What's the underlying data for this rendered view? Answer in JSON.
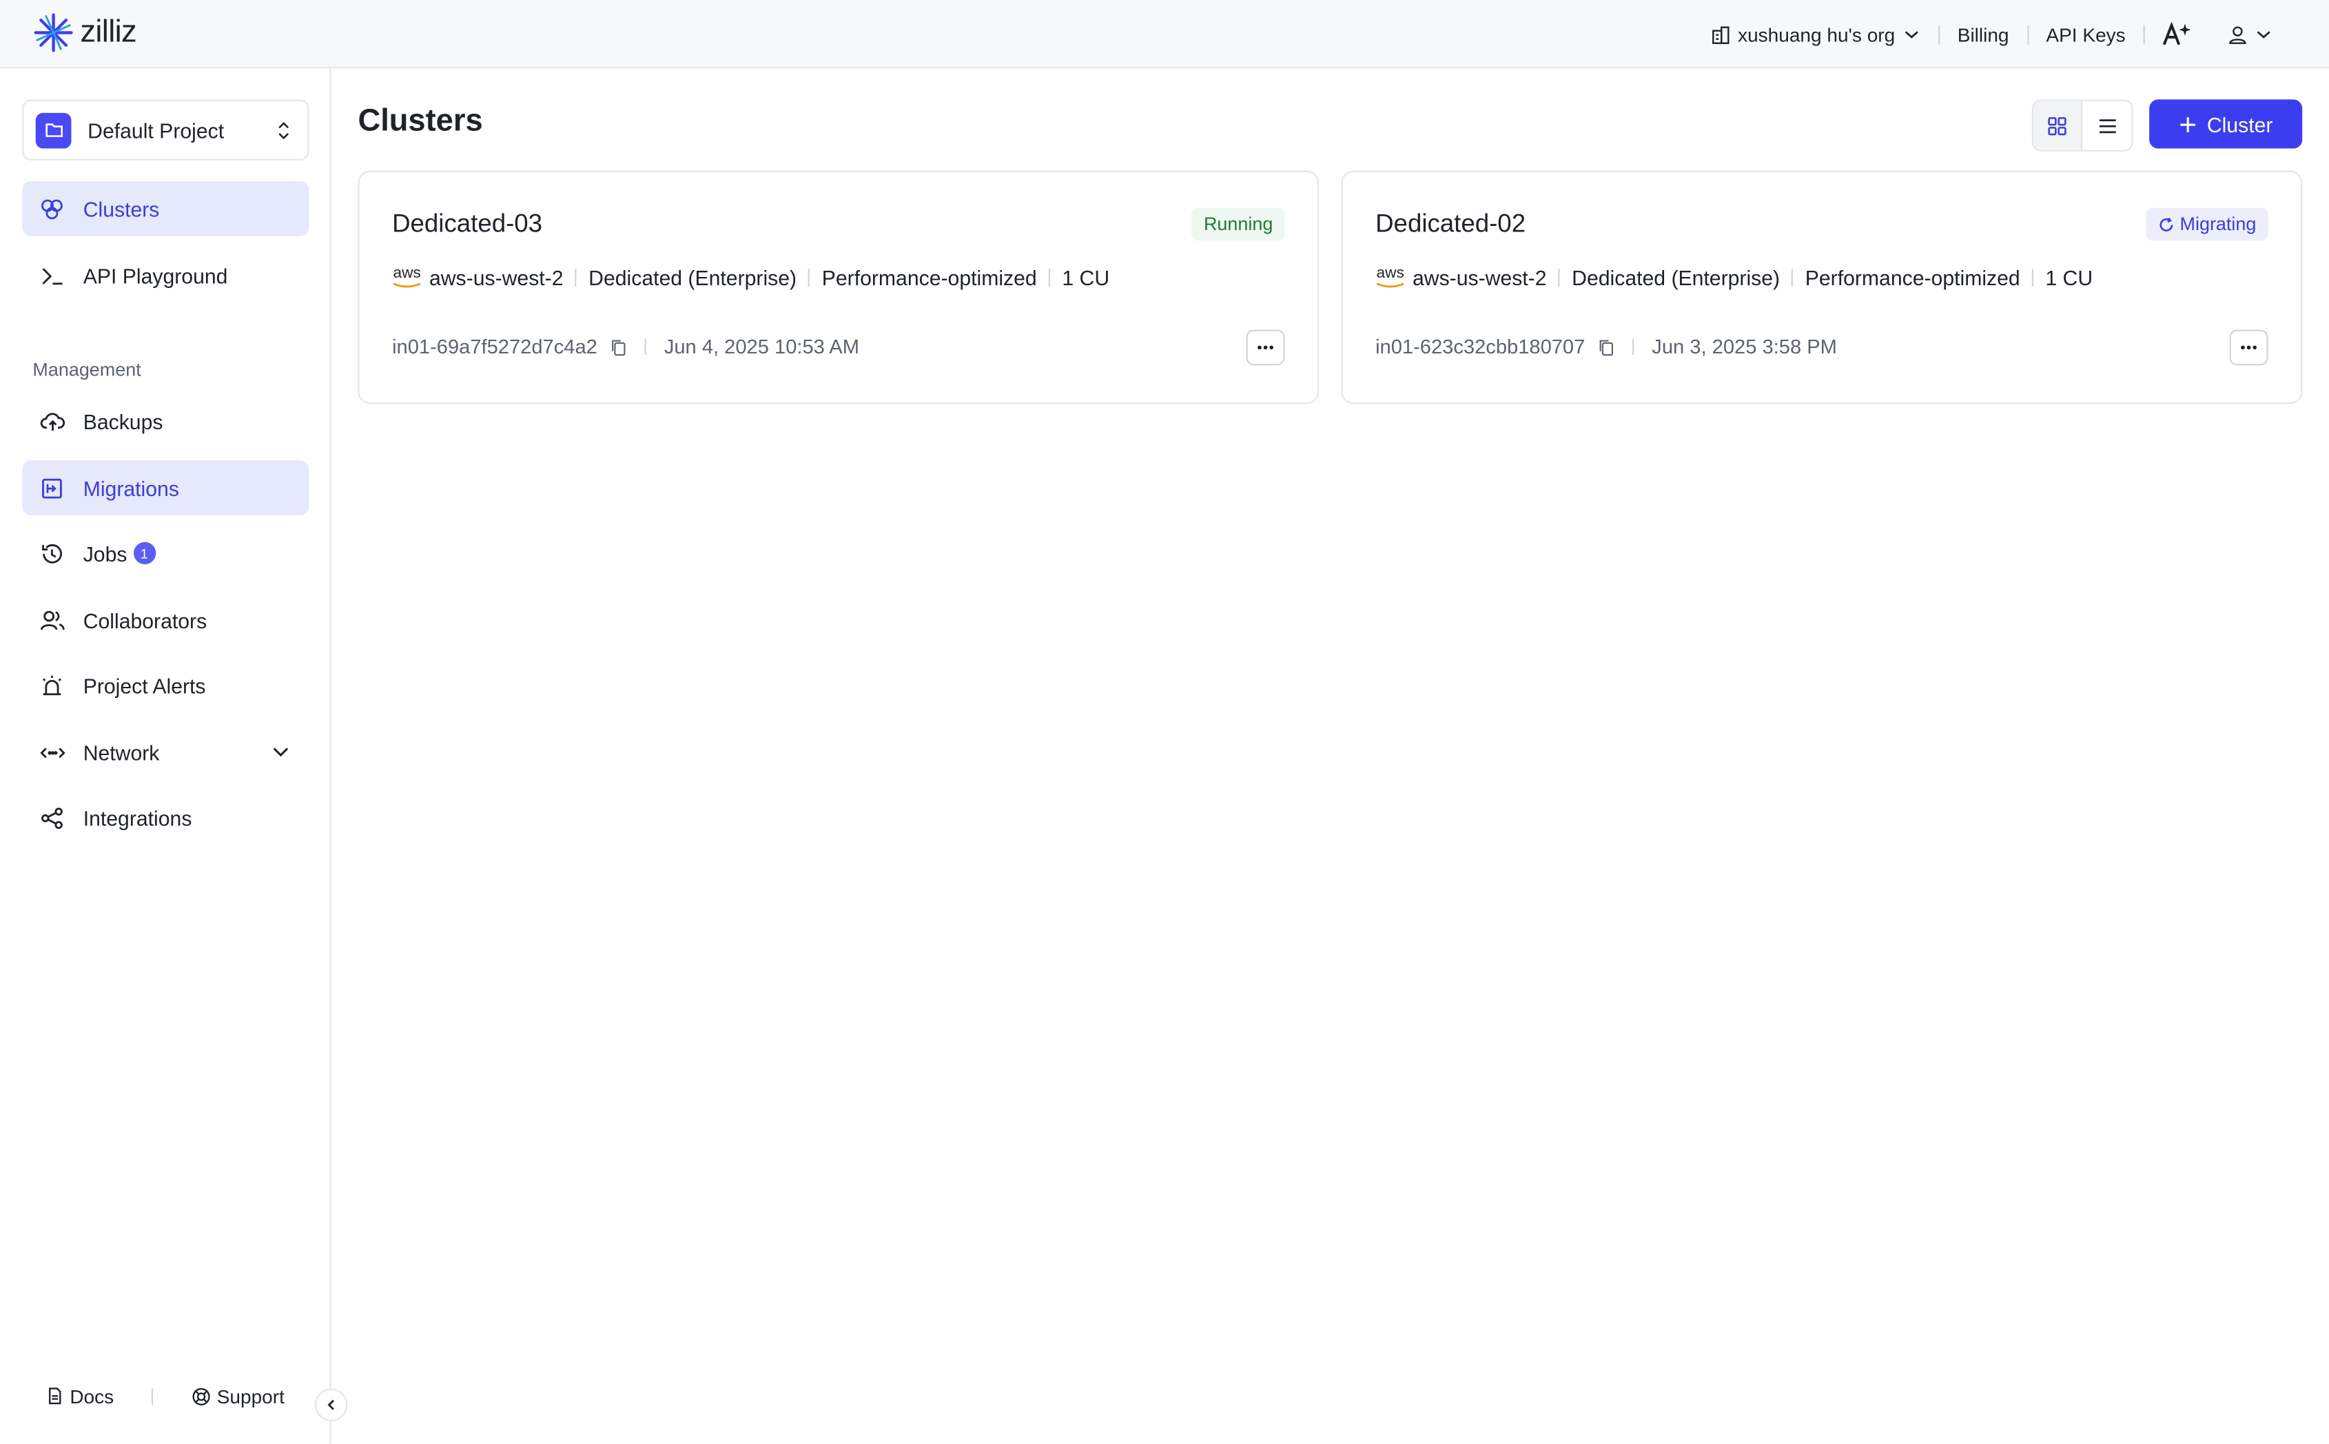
{
  "brand": {
    "name": "zilliz"
  },
  "topbar": {
    "org": "xushuang hu's org",
    "billing": "Billing",
    "api_keys": "API Keys"
  },
  "sidebar": {
    "project": "Default Project",
    "items": [
      {
        "label": "Clusters",
        "icon": "clusters-icon"
      },
      {
        "label": "API Playground",
        "icon": "terminal-icon"
      }
    ],
    "section_label": "Management",
    "management": [
      {
        "label": "Backups",
        "icon": "cloud-upload-icon"
      },
      {
        "label": "Migrations",
        "icon": "migrate-icon"
      },
      {
        "label": "Jobs",
        "icon": "history-icon",
        "badge": "1"
      },
      {
        "label": "Collaborators",
        "icon": "users-icon"
      },
      {
        "label": "Project Alerts",
        "icon": "alarm-icon"
      },
      {
        "label": "Network",
        "icon": "network-icon"
      },
      {
        "label": "Integrations",
        "icon": "share-icon"
      }
    ],
    "footer": {
      "docs": "Docs",
      "support": "Support"
    }
  },
  "main": {
    "title": "Clusters",
    "add_button": "Cluster",
    "clusters": [
      {
        "name": "Dedicated-03",
        "status": "Running",
        "provider": "aws",
        "region": "aws-us-west-2",
        "plan": "Dedicated (Enterprise)",
        "type": "Performance-optimized",
        "size": "1 CU",
        "id": "in01-69a7f5272d7c4a2",
        "created": "Jun 4, 2025 10:53 AM"
      },
      {
        "name": "Dedicated-02",
        "status": "Migrating",
        "provider": "aws",
        "region": "aws-us-west-2",
        "plan": "Dedicated (Enterprise)",
        "type": "Performance-optimized",
        "size": "1 CU",
        "id": "in01-623c32cbb180707",
        "created": "Jun 3, 2025 3:58 PM"
      }
    ]
  },
  "colors": {
    "accent": "#3b3ef0",
    "active_bg": "#e6e8fb",
    "running": "#1f7a3a",
    "migrating": "#3b3ed8"
  }
}
